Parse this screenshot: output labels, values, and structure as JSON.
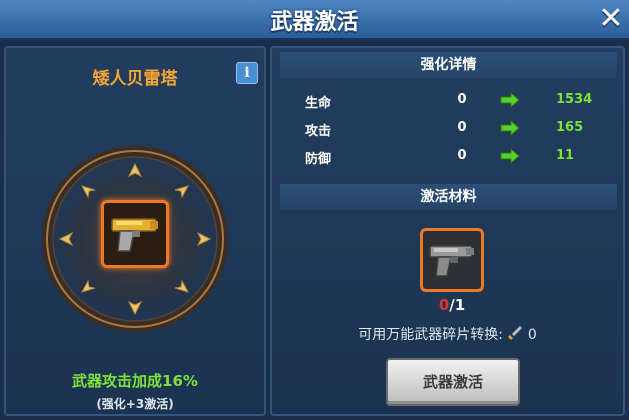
{
  "header": {
    "title": "武器激活",
    "close_icon": "close-icon"
  },
  "left": {
    "hero_name": "矮人贝雷塔",
    "info_label": "i",
    "weapon_icon": "pistol-icon",
    "bonus_text": "武器攻击加成16%",
    "bonus_sub": "(强化+3激活)"
  },
  "right": {
    "detail_title": "强化详情",
    "stats": [
      {
        "label": "生命",
        "before": "0",
        "after": "1534"
      },
      {
        "label": "攻击",
        "before": "0",
        "after": "165"
      },
      {
        "label": "防御",
        "before": "0",
        "after": "11"
      }
    ],
    "material_title": "激活材料",
    "material_icon": "pistol-icon",
    "material_have": "0",
    "material_need": "/1",
    "convert_text": "可用万能武器碎片转换:",
    "convert_icon": "sword-fragment-icon",
    "convert_count": "0",
    "activate_label": "武器激活"
  },
  "colors": {
    "accent_orange": "#f6a534",
    "green": "#7ee23a",
    "red": "#e8322d",
    "title_blue": "#3c75b5"
  }
}
